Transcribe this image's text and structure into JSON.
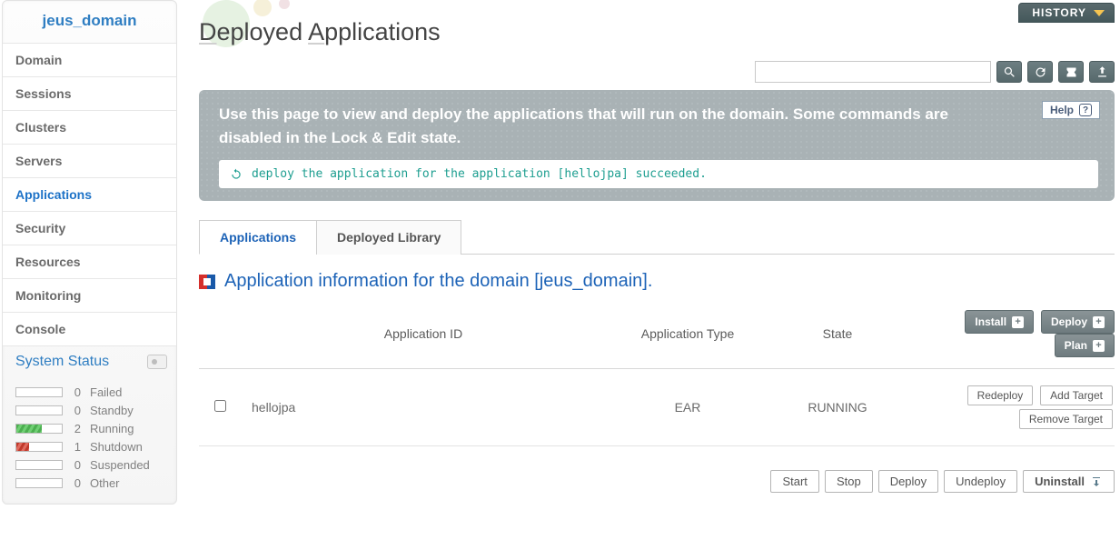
{
  "domain_name": "jeus_domain",
  "sidebar": {
    "items": [
      {
        "label": "Domain"
      },
      {
        "label": "Sessions"
      },
      {
        "label": "Clusters"
      },
      {
        "label": "Servers"
      },
      {
        "label": "Applications",
        "active": true
      },
      {
        "label": "Security"
      },
      {
        "label": "Resources"
      },
      {
        "label": "Monitoring"
      },
      {
        "label": "Console"
      }
    ],
    "status_title": "System Status",
    "status": [
      {
        "count": "0",
        "label": "Failed"
      },
      {
        "count": "0",
        "label": "Standby"
      },
      {
        "count": "2",
        "label": "Running"
      },
      {
        "count": "1",
        "label": "Shutdown"
      },
      {
        "count": "0",
        "label": "Suspended"
      },
      {
        "count": "0",
        "label": "Other"
      }
    ]
  },
  "header": {
    "history_label": "HISTORY",
    "page_title_1": "D",
    "page_title_2": "eployed ",
    "page_title_3": "A",
    "page_title_4": "pplications"
  },
  "banner": {
    "text": "Use this page to view and deploy the applications that will run on the domain. Some commands are disabled in the Lock & Edit state.",
    "help_label": "Help",
    "success_msg": "deploy the application for the application [hellojpa] succeeded."
  },
  "tabs": [
    {
      "label": "Applications",
      "active": true
    },
    {
      "label": "Deployed Library"
    }
  ],
  "section_title": "Application information for the domain [jeus_domain].",
  "table": {
    "columns": {
      "app_id": "Application ID",
      "app_type": "Application Type",
      "state": "State"
    },
    "header_actions": {
      "install": "Install",
      "deploy": "Deploy",
      "plan": "Plan"
    },
    "rows": [
      {
        "app_id": "hellojpa",
        "app_type": "EAR",
        "state": "RUNNING"
      }
    ],
    "row_actions": {
      "redeploy": "Redeploy",
      "add_target": "Add Target",
      "remove_target": "Remove Target"
    }
  },
  "footer_actions": {
    "start": "Start",
    "stop": "Stop",
    "deploy": "Deploy",
    "undeploy": "Undeploy",
    "uninstall": "Uninstall"
  }
}
